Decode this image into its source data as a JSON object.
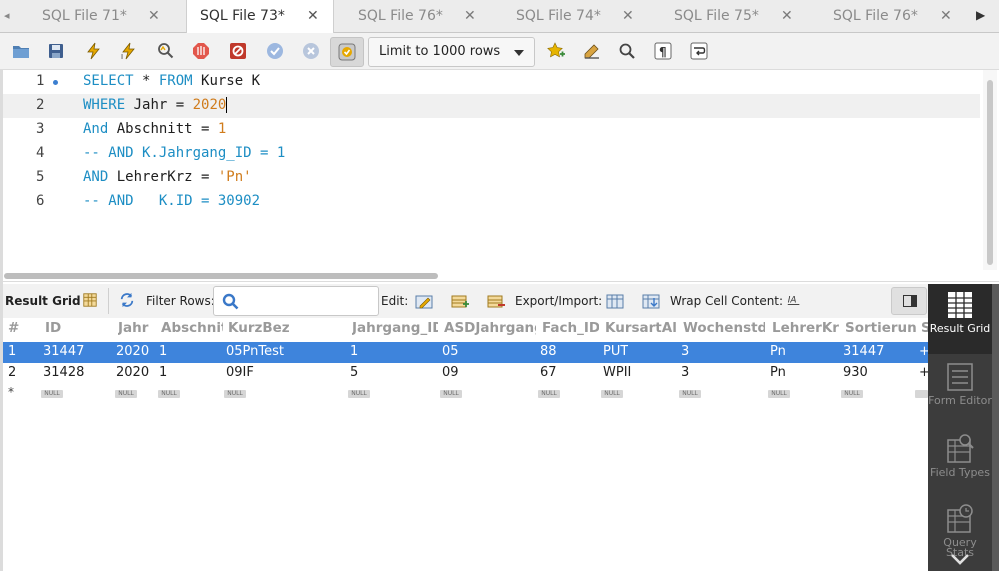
{
  "tabs": [
    {
      "label": "SQL File 71*",
      "active": false
    },
    {
      "label": "SQL File 73*",
      "active": true
    },
    {
      "label": "SQL File 76*",
      "active": false
    },
    {
      "label": "SQL File 74*",
      "active": false
    },
    {
      "label": "SQL File 75*",
      "active": false
    },
    {
      "label": "SQL File 76*",
      "active": false
    }
  ],
  "toolbar": {
    "limit_label": "Limit to 1000 rows",
    "icons": [
      "open-folder-icon",
      "save-icon",
      "execute-icon",
      "execute-current-icon",
      "explain-icon",
      "stop-icon",
      "error-stop-icon",
      "commit-icon",
      "rollback-icon",
      "autocommit-icon",
      "bookmark-icon",
      "beautify-icon",
      "find-icon",
      "invisible-chars-icon",
      "wrap-icon"
    ]
  },
  "editor": {
    "lines": [
      {
        "num": "1",
        "tokens": [
          {
            "t": "SELECT",
            "c": "kw"
          },
          {
            "t": " * ",
            "c": "id"
          },
          {
            "t": "FROM",
            "c": "kw"
          },
          {
            "t": " Kurse K",
            "c": "id"
          }
        ]
      },
      {
        "num": "2",
        "tokens": [
          {
            "t": "WHERE",
            "c": "kw"
          },
          {
            "t": " Jahr = ",
            "c": "id"
          },
          {
            "t": "2020",
            "c": "num"
          }
        ]
      },
      {
        "num": "3",
        "tokens": [
          {
            "t": "And",
            "c": "kw"
          },
          {
            "t": " Abschnitt = ",
            "c": "id"
          },
          {
            "t": "1",
            "c": "num"
          }
        ]
      },
      {
        "num": "4",
        "tokens": [
          {
            "t": "-- AND K.Jahrgang_ID = 1",
            "c": "cm"
          }
        ]
      },
      {
        "num": "5",
        "tokens": [
          {
            "t": "AND",
            "c": "kw"
          },
          {
            "t": " LehrerKrz = ",
            "c": "id"
          },
          {
            "t": "'Pn'",
            "c": "str"
          }
        ]
      },
      {
        "num": "6",
        "tokens": [
          {
            "t": "-- AND   K.ID = 30902",
            "c": "cm"
          }
        ]
      }
    ],
    "current_line": 2
  },
  "results_toolbar": {
    "result_grid_label": "Result Grid",
    "filter_rows_label": "Filter Rows:",
    "filter_value": "",
    "edit_label": "Edit:",
    "export_label": "Export/Import:",
    "wrap_label": "Wrap Cell Content:"
  },
  "grid": {
    "columns": [
      "#",
      "ID",
      "Jahr",
      "Abschnitt",
      "KurzBez",
      "Jahrgang_ID",
      "ASDJahrgang",
      "Fach_ID",
      "KursartAllg",
      "Wochenstd",
      "LehrerKrz",
      "Sortierung",
      "S"
    ],
    "rows": [
      {
        "num": "1",
        "cells": [
          "31447",
          "2020",
          "1",
          "05PnTest",
          "1",
          "05",
          "88",
          "PUT",
          "3",
          "Pn",
          "31447",
          "+"
        ],
        "selected": true
      },
      {
        "num": "2",
        "cells": [
          "31428",
          "2020",
          "1",
          "09IF",
          "5",
          "09",
          "67",
          "WPII",
          "3",
          "Pn",
          "930",
          "+"
        ],
        "selected": false
      }
    ],
    "new_row_marker": "*",
    "null_label": "NULL"
  },
  "side_panel": {
    "items": [
      {
        "label": "Result Grid",
        "active": true
      },
      {
        "label": "Form Editor",
        "active": false
      },
      {
        "label": "Field Types",
        "active": false
      },
      {
        "label": "Query Stats",
        "active": false
      }
    ]
  }
}
